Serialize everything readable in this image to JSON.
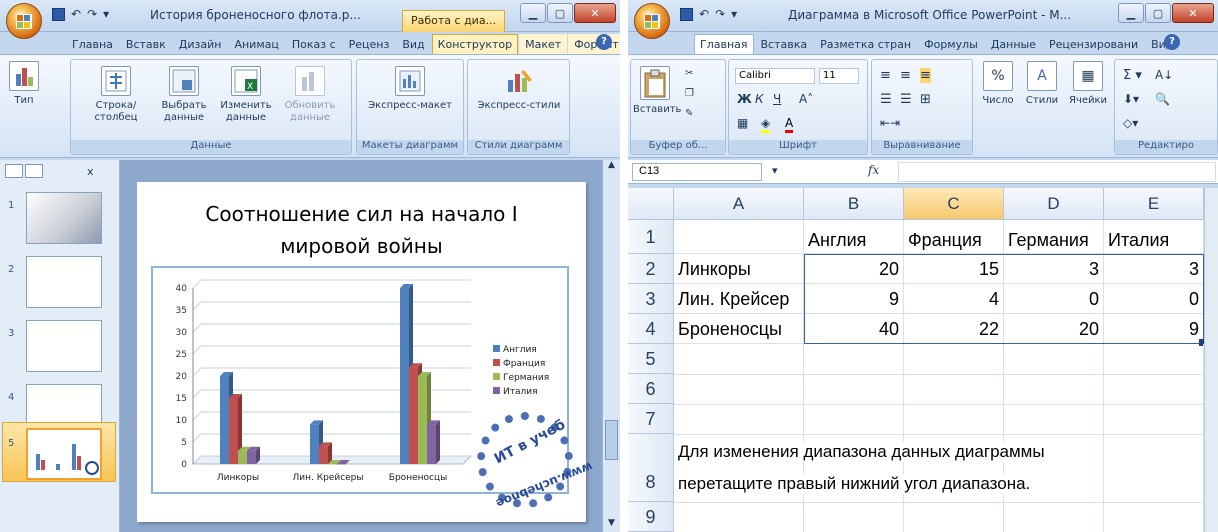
{
  "ppt": {
    "title": "История броненосного флота.p...",
    "context_tab": "Работа с диа...",
    "tabs": [
      "Главна",
      "Вставк",
      "Дизайн",
      "Анимац",
      "Показ с",
      "Реценз",
      "Вид",
      "Конструктор",
      "Макет",
      "Формат"
    ],
    "selected_tab": "Конструктор",
    "ribbon": {
      "type_label": "Тип",
      "row_col_label": "Строка/столбец",
      "select_data_label": "Выбрать данные",
      "edit_data_label": "Изменить данные",
      "refresh_label": "Обновить данные",
      "data_group": "Данные",
      "express_layout_label": "Экспресс-макет",
      "layouts_group": "Макеты диаграмм",
      "express_styles_label": "Экспресс-стили",
      "styles_group": "Стили диаграмм"
    },
    "slide_numbers": [
      "1",
      "2",
      "3",
      "4",
      "5"
    ],
    "slide_title": "Соотношение сил на начало I мировой войны",
    "watermark_top": "ИТ в учеб",
    "watermark_bottom": "www.uchebnoe"
  },
  "chart_data": {
    "type": "bar",
    "categories": [
      "Линкоры",
      "Лин. Крейсеры",
      "Броненосцы"
    ],
    "series": [
      {
        "name": "Англия",
        "values": [
          20,
          9,
          40
        ],
        "color": "#4f81bd"
      },
      {
        "name": "Франция",
        "values": [
          15,
          4,
          22
        ],
        "color": "#c0504d"
      },
      {
        "name": "Германия",
        "values": [
          3,
          0,
          20
        ],
        "color": "#9bbb59"
      },
      {
        "name": "Италия",
        "values": [
          3,
          0,
          9
        ],
        "color": "#8064a2"
      }
    ],
    "yticks": [
      "0",
      "5",
      "10",
      "15",
      "20",
      "25",
      "30",
      "35",
      "40"
    ],
    "ylim": [
      0,
      40
    ],
    "grid": true,
    "legend": "right",
    "style": "3d-clustered-column"
  },
  "excel": {
    "title": "Диаграмма в Microsoft Office PowerPoint - M...",
    "tabs": [
      "Главная",
      "Вставка",
      "Разметка стран",
      "Формулы",
      "Данные",
      "Рецензировани",
      "Вид"
    ],
    "selected_tab": "Главная",
    "ribbon": {
      "paste_label": "Вставить",
      "clipboard_group": "Буфер об...",
      "font_name": "Calibri",
      "font_size": "11",
      "font_group": "Шрифт",
      "align_group": "Выравнивание",
      "number_label": "Число",
      "styles_label": "Стили",
      "cells_label": "Ячейки",
      "edit_group": "Редактиро"
    },
    "name_box": "C13",
    "fx": "fx",
    "columns": [
      "A",
      "B",
      "C",
      "D",
      "E"
    ],
    "rows": [
      "1",
      "2",
      "3",
      "4",
      "5",
      "6",
      "7",
      "8",
      "9"
    ],
    "header_row": [
      "",
      "Англия",
      "Франция",
      "Германия",
      "Италия"
    ],
    "data_rows": [
      [
        "Линкоры",
        "20",
        "15",
        "3",
        "3"
      ],
      [
        "Лин. Крейсер",
        "9",
        "4",
        "0",
        "0"
      ],
      [
        "Броненосцы",
        "40",
        "22",
        "20",
        "9"
      ]
    ],
    "note_line1": "Для изменения диапазона данных диаграммы",
    "note_line2": "перетащите правый нижний угол диапазона."
  }
}
